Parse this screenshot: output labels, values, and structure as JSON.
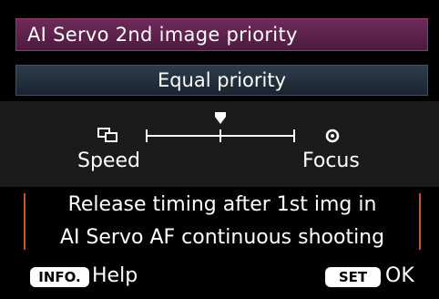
{
  "menu": {
    "title": "AI Servo 2nd image priority",
    "selected_mode": "Equal priority"
  },
  "scale": {
    "left_label": "Speed",
    "right_label": "Focus",
    "position": "center",
    "steps": 3
  },
  "description": {
    "line1": "Release timing after 1st img in",
    "line2": "AI Servo AF continuous shooting"
  },
  "footer": {
    "info_badge": "INFO.",
    "info_label": "Help",
    "set_badge": "SET",
    "set_label": "OK"
  },
  "colors": {
    "title_bg": "#5e2250",
    "mode_bg": "#25323f",
    "accent_bracket": "#c2592a"
  },
  "icons": {
    "left": "speed-frames-icon",
    "right": "focus-target-icon",
    "marker": "pointer-triangle-icon"
  }
}
